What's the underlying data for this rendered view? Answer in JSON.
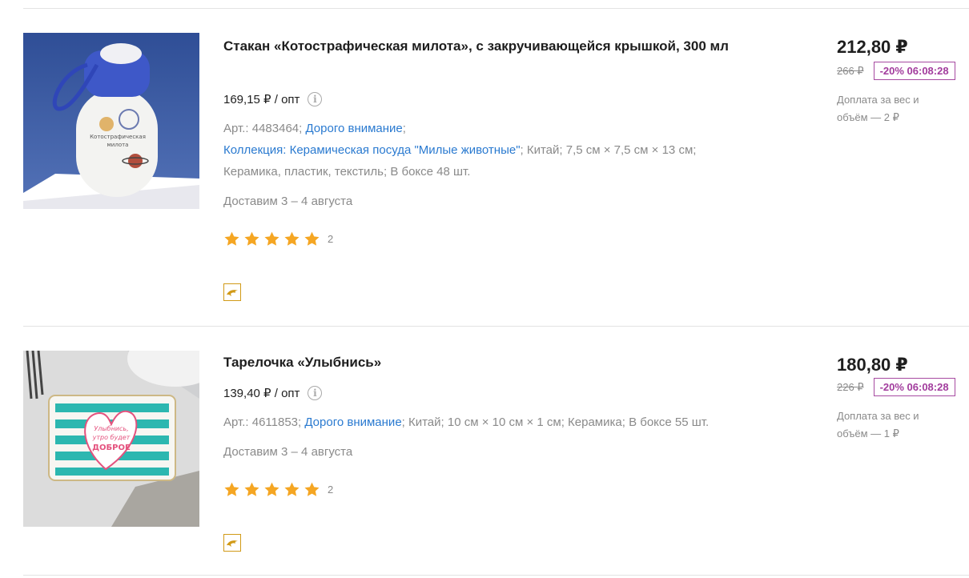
{
  "products": [
    {
      "title": "Стакан «Котострафическая милота», с закручивающейся крышкой, 300 мл",
      "wholesale": "169,15 ₽ / опт",
      "article": "Арт.: 4483464;",
      "tag": "Дорого внимание",
      "tag_sep": ";",
      "collection": "Коллекция: Керамическая посуда \"Милые животные\"",
      "details_line1": "; Китай; 7,5 см × 7,5 см × 13 см;",
      "details_line2": "Керамика, пластик, текстиль; В боксе 48 шт.",
      "delivery": "Доставим 3 – 4 августа",
      "rating_count": "2",
      "price": "212,80 ₽",
      "old_price": "266 ₽",
      "discount": "-20% 06:08:28",
      "surcharge": "Доплата за вес и объём — 2 ₽",
      "image_text": "Котострафическая милота"
    },
    {
      "title": "Тарелочка «Улыбнись»",
      "wholesale": "139,40 ₽ / опт",
      "article": "Арт.: 4611853;",
      "tag": "Дорого внимание",
      "details_line1": "; Китай; 10 см × 10 см × 1 см; Керамика; В боксе 55 шт.",
      "delivery": "Доставим 3 – 4 августа",
      "rating_count": "2",
      "price": "180,80 ₽",
      "old_price": "226 ₽",
      "discount": "-20% 06:08:28",
      "surcharge": "Доплата за вес и объём — 1 ₽",
      "image_text": "Улыбнись, утро будет доброе"
    }
  ],
  "icons": {
    "info": "info-icon",
    "star": "star-icon",
    "badge": "dolphin-badge-icon"
  },
  "colors": {
    "link": "#2a7ad0",
    "star": "#f5a623",
    "discount": "#a23c9d",
    "badge": "#d19a17"
  }
}
